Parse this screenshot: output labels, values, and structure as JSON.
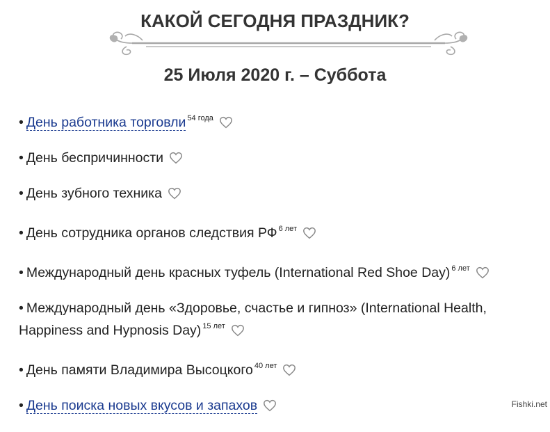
{
  "header": {
    "title": "КАКОЙ СЕГОДНЯ ПРАЗДНИК?",
    "date": "25 Июля 2020 г. – Суббота"
  },
  "holidays": [
    {
      "label": "День работника торговли",
      "years": "54 года",
      "link": true
    },
    {
      "label": "День беспричинности",
      "years": "",
      "link": false
    },
    {
      "label": "День зубного техника",
      "years": "",
      "link": false
    },
    {
      "label": "День сотрудника органов следствия РФ",
      "years": "6 лет",
      "link": false
    },
    {
      "label": "Международный день красных туфель (International Red Shoe Day)",
      "years": "6 лет",
      "link": false
    },
    {
      "label": "Международный день «Здоровье, счастье и гипноз» (International Health, Happiness and Hypnosis Day)",
      "years": "15 лет",
      "link": false
    },
    {
      "label": "День памяти Владимира Высоцкого",
      "years": "40 лет",
      "link": false
    },
    {
      "label": "День поиска новых вкусов и запахов",
      "years": "",
      "link": true
    }
  ],
  "icons": {
    "favorite": "heart-outline-icon",
    "ornament": "flourish-divider"
  },
  "colors": {
    "link": "#1a3a8f",
    "text": "#222222",
    "heart": "#888888",
    "ornament": "#aaaaaa"
  },
  "watermark": "Fishki.net"
}
